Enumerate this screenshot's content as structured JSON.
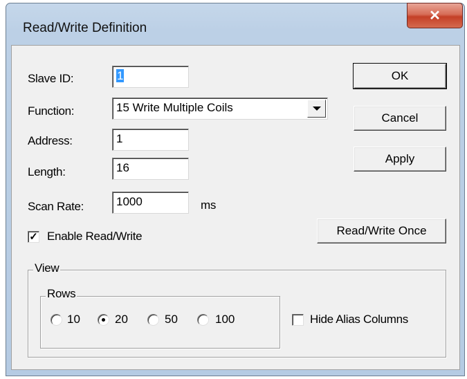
{
  "window": {
    "title": "Read/Write Definition",
    "close_icon": "close-icon"
  },
  "form": {
    "slave_id_label": "Slave ID:",
    "slave_id_value": "1",
    "function_label": "Function:",
    "function_value": "15 Write Multiple Coils",
    "address_label": "Address:",
    "address_value": "1",
    "length_label": "Length:",
    "length_value": "16",
    "scan_rate_label": "Scan Rate:",
    "scan_rate_value": "1000",
    "scan_rate_unit": "ms",
    "enable_label": "Enable Read/Write",
    "enable_checked": true
  },
  "buttons": {
    "ok": "OK",
    "cancel": "Cancel",
    "apply": "Apply",
    "read_write_once": "Read/Write Once"
  },
  "view": {
    "group_label": "View",
    "rows_label": "Rows",
    "rows_options": [
      "10",
      "20",
      "50",
      "100"
    ],
    "rows_selected": "20",
    "hide_alias_label": "Hide Alias Columns",
    "hide_alias_checked": false
  }
}
